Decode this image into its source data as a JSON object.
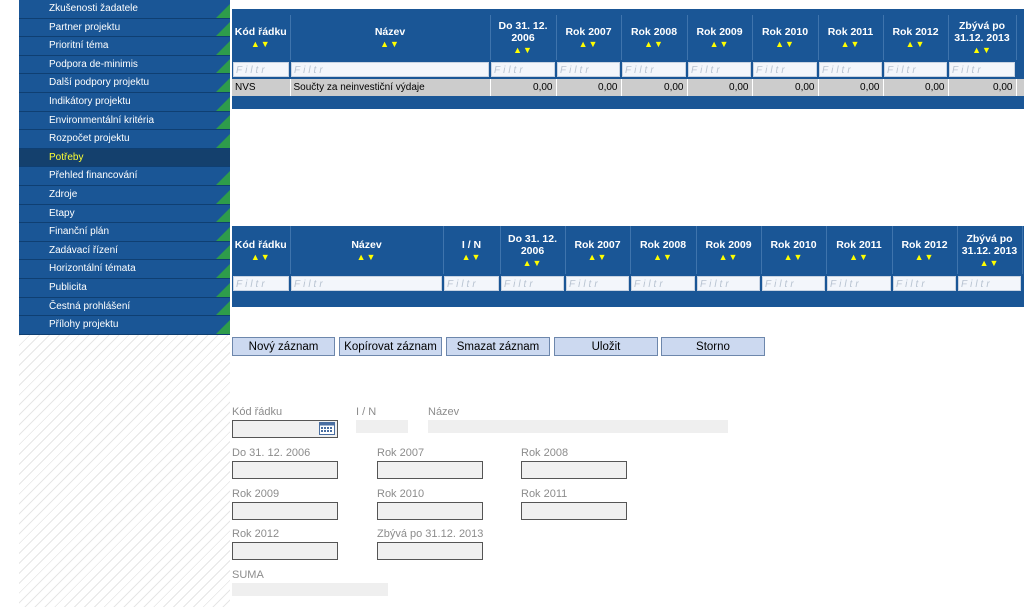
{
  "sidebar": {
    "items": [
      {
        "label": "Zkušenosti žadatele",
        "active": false
      },
      {
        "label": "Partner projektu",
        "active": false
      },
      {
        "label": "Prioritní téma",
        "active": false
      },
      {
        "label": "Podpora de-minimis",
        "active": false
      },
      {
        "label": "Další podpory projektu",
        "active": false
      },
      {
        "label": "Indikátory projektu",
        "active": false
      },
      {
        "label": "Environmentální kritéria",
        "active": false
      },
      {
        "label": "Rozpočet projektu",
        "active": false
      },
      {
        "label": "Potřeby",
        "active": true
      },
      {
        "label": "Přehled financování",
        "active": false
      },
      {
        "label": "Zdroje",
        "active": false
      },
      {
        "label": "Etapy",
        "active": false
      },
      {
        "label": "Finanční plán",
        "active": false
      },
      {
        "label": "Zadávací řízení",
        "active": false
      },
      {
        "label": "Horizontální témata",
        "active": false
      },
      {
        "label": "Publicita",
        "active": false
      },
      {
        "label": "Čestná prohlášení",
        "active": false
      },
      {
        "label": "Přílohy projektu",
        "active": false
      }
    ]
  },
  "grid1": {
    "headers": [
      "Kód řádku",
      "Název",
      "Do 31. 12. 2006",
      "Rok 2007",
      "Rok 2008",
      "Rok 2009",
      "Rok 2010",
      "Rok 2011",
      "Rok 2012",
      "Zbývá po 31.12. 2013"
    ],
    "filter_placeholder": "Filtr",
    "sort_glyph": "▲▼",
    "rows": [
      [
        "NVS",
        "Součty za neinvestiční výdaje",
        "0,00",
        "0,00",
        "0,00",
        "0,00",
        "0,00",
        "0,00",
        "0,00",
        "0,00"
      ]
    ]
  },
  "grid2": {
    "headers": [
      "Kód řádku",
      "Název",
      "I / N",
      "Do 31. 12. 2006",
      "Rok 2007",
      "Rok 2008",
      "Rok 2009",
      "Rok 2010",
      "Rok 2011",
      "Rok 2012",
      "Zbývá po 31.12. 2013"
    ],
    "filter_placeholder": "Filtr",
    "sort_glyph": "▲▼"
  },
  "buttons": {
    "new": "Nový záznam",
    "copy": "Kopírovat záznam",
    "delete": "Smazat záznam",
    "save": "Uložit",
    "cancel": "Storno"
  },
  "form": {
    "kod_radku": "Kód řádku",
    "in": "I / N",
    "nazev": "Název",
    "do2006": "Do 31. 12. 2006",
    "r2007": "Rok 2007",
    "r2008": "Rok 2008",
    "r2009": "Rok 2009",
    "r2010": "Rok 2010",
    "r2011": "Rok 2011",
    "r2012": "Rok 2012",
    "zbyva": "Zbývá po 31.12. 2013",
    "suma": "SUMA"
  }
}
